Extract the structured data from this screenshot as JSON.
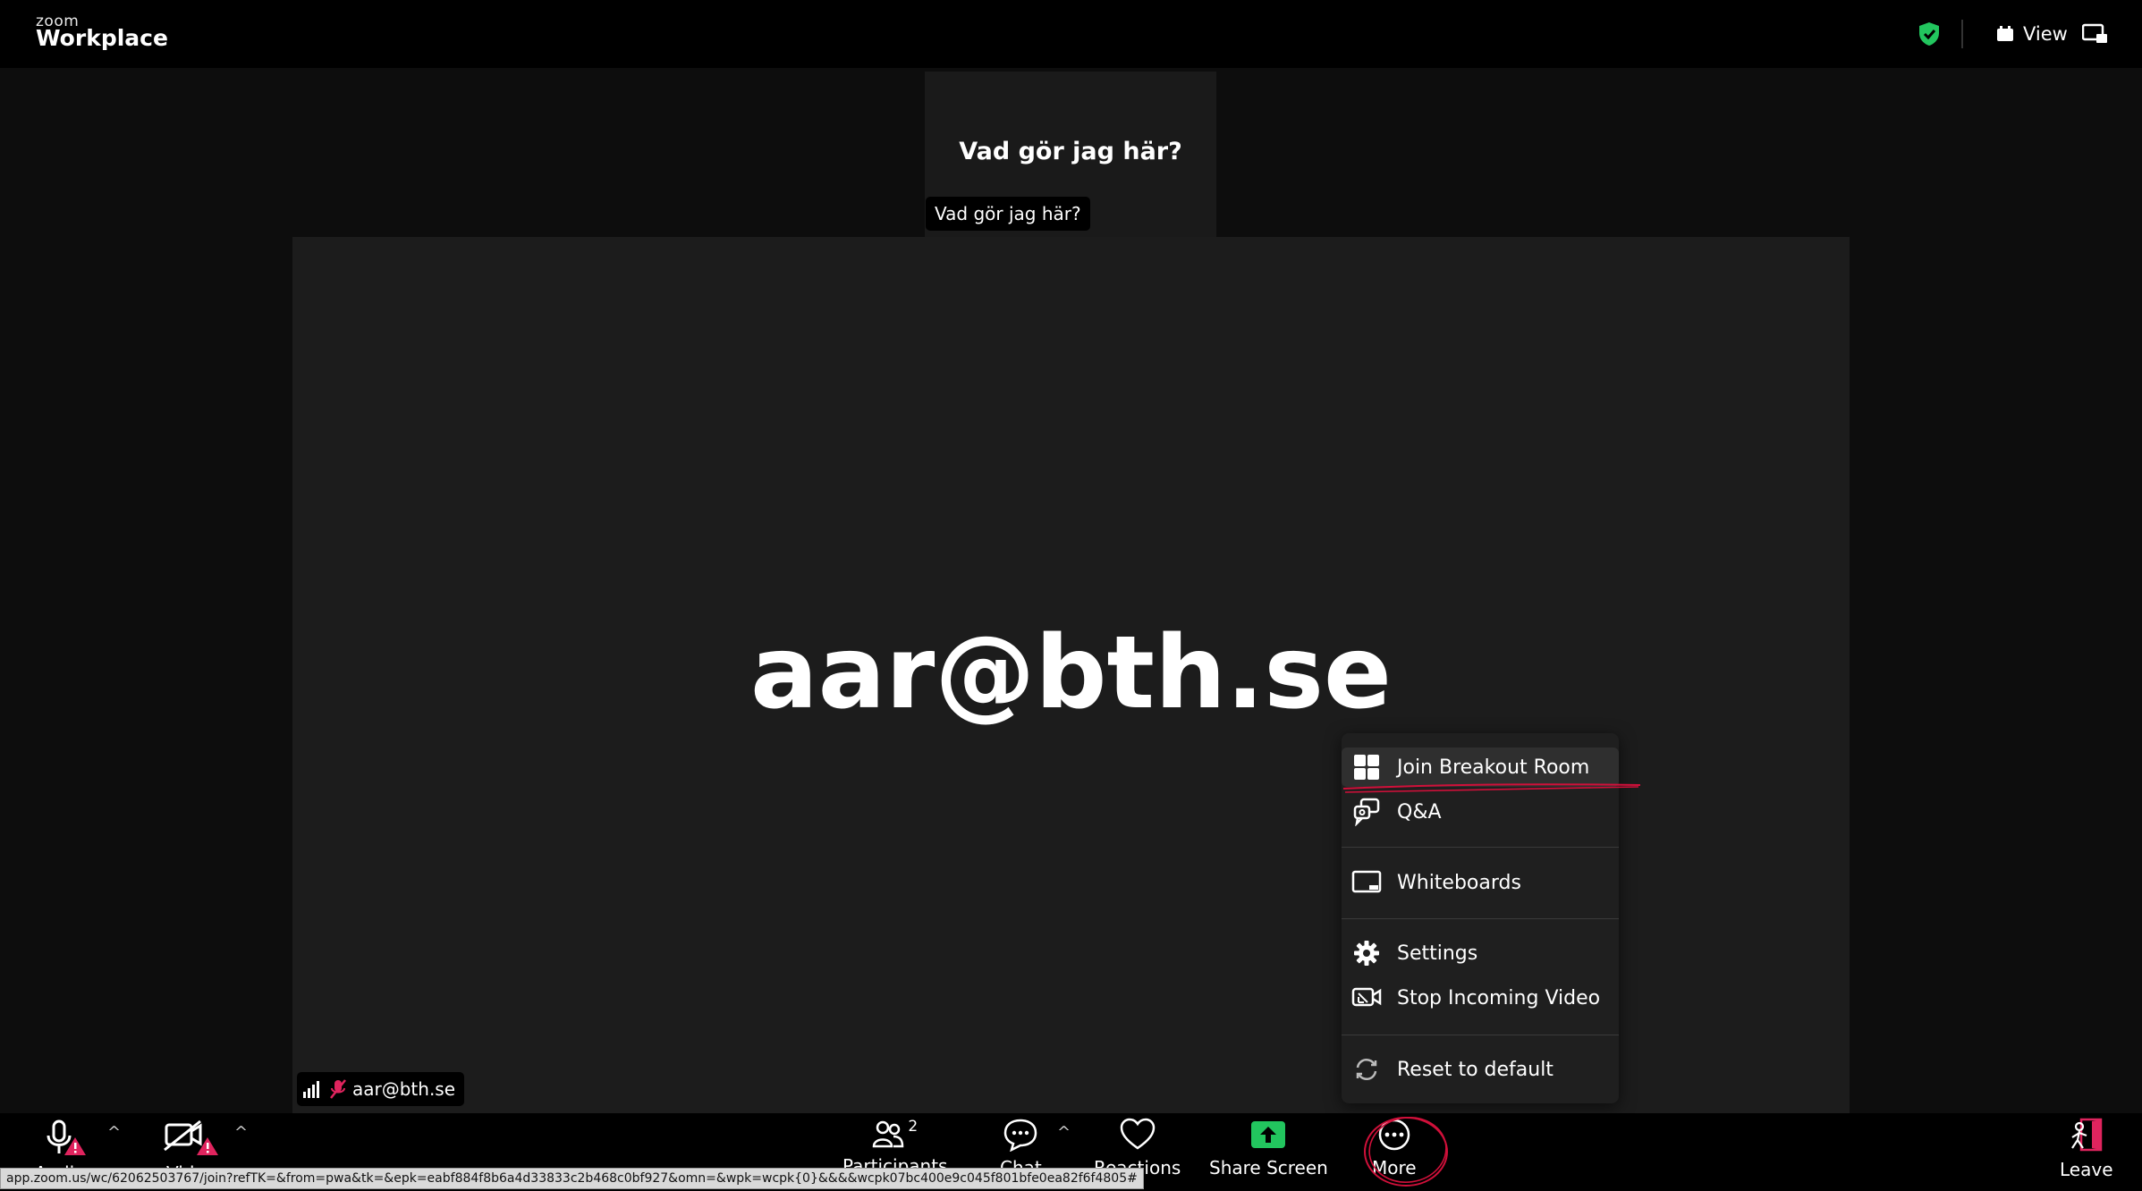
{
  "app": {
    "brand_top": "zoom",
    "brand_main": "Workplace"
  },
  "header": {
    "view_label": "View"
  },
  "speaker": {
    "title": "Vad gör jag här?",
    "tag": "Vad gör jag här?"
  },
  "video": {
    "display_name": "aar@bth.se",
    "tag_name": "aar@bth.se"
  },
  "menu": {
    "items": [
      {
        "label": "Join Breakout Room",
        "icon": "breakout-grid-icon"
      },
      {
        "label": "Q&A",
        "icon": "qa-icon"
      },
      {
        "label": "Whiteboards",
        "icon": "whiteboard-icon"
      },
      {
        "label": "Settings",
        "icon": "gear-icon"
      },
      {
        "label": "Stop Incoming Video",
        "icon": "video-off-icon"
      },
      {
        "label": "Reset to default",
        "icon": "reset-icon"
      }
    ]
  },
  "toolbar": {
    "audio_label": "Audio",
    "video_label": "Video",
    "participants_label": "Participants",
    "participants_count": "2",
    "chat_label": "Chat",
    "reactions_label": "Reactions",
    "share_label": "Share Screen",
    "more_label": "More",
    "leave_label": "Leave"
  },
  "status_url": "app.zoom.us/wc/62062503767/join?refTK=&from=pwa&tk=&epk=eabf884f8b6a4d33833c2b468c0bf927&omn=&wpk=wcpk{0}&&&&wcpk07bc400e9c045f801bfe0ea82f6f4805#",
  "colors": {
    "accent_green": "#22c55e",
    "alert_red": "#e0245e",
    "annotation_red": "#d0103a"
  }
}
